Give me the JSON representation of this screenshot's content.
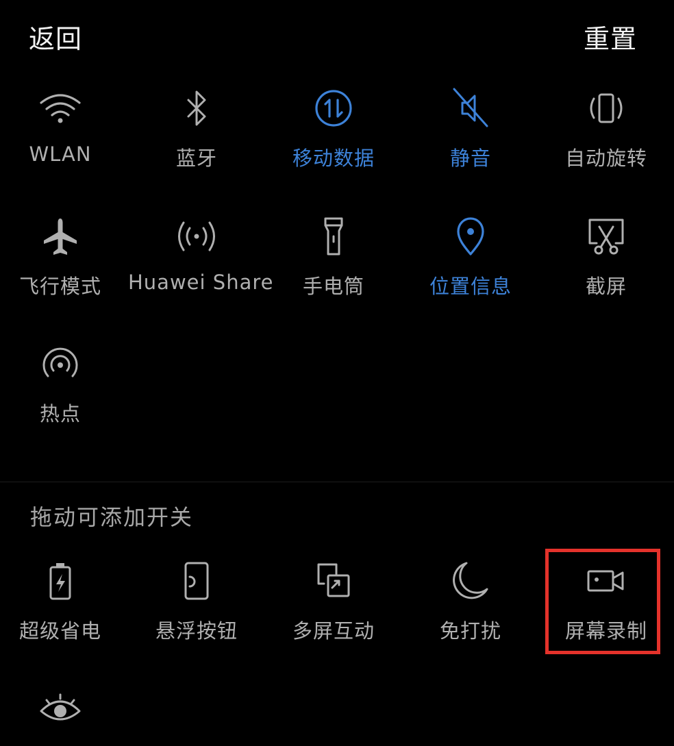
{
  "header": {
    "back_label": "返回",
    "reset_label": "重置"
  },
  "active_tiles": {
    "row1": [
      {
        "id": "wlan",
        "label": "WLAN",
        "icon": "wifi-icon",
        "on": false
      },
      {
        "id": "bluetooth",
        "label": "蓝牙",
        "icon": "bluetooth-icon",
        "on": false
      },
      {
        "id": "mobile-data",
        "label": "移动数据",
        "icon": "mobile-data-icon",
        "on": true
      },
      {
        "id": "mute",
        "label": "静音",
        "icon": "mute-icon",
        "on": true
      },
      {
        "id": "auto-rotate",
        "label": "自动旋转",
        "icon": "rotate-icon",
        "on": false
      }
    ],
    "row2": [
      {
        "id": "airplane",
        "label": "飞行模式",
        "icon": "airplane-icon",
        "on": false
      },
      {
        "id": "huawei-share",
        "label": "Huawei Share",
        "icon": "share-signal-icon",
        "on": false
      },
      {
        "id": "flashlight",
        "label": "手电筒",
        "icon": "flashlight-icon",
        "on": false
      },
      {
        "id": "location",
        "label": "位置信息",
        "icon": "location-pin-icon",
        "on": true
      },
      {
        "id": "screenshot",
        "label": "截屏",
        "icon": "screenshot-icon",
        "on": false
      }
    ],
    "row3": [
      {
        "id": "hotspot",
        "label": "热点",
        "icon": "hotspot-icon",
        "on": false
      }
    ]
  },
  "drag_section": {
    "title": "拖动可添加开关",
    "tiles": [
      {
        "id": "super-power-saving",
        "label": "超级省电",
        "icon": "battery-bolt-icon"
      },
      {
        "id": "floating-button",
        "label": "悬浮按钮",
        "icon": "floating-button-icon"
      },
      {
        "id": "multi-screen",
        "label": "多屏互动",
        "icon": "multi-screen-icon"
      },
      {
        "id": "do-not-disturb",
        "label": "免打扰",
        "icon": "moon-icon"
      },
      {
        "id": "screen-record",
        "label": "屏幕录制",
        "icon": "video-camera-icon",
        "highlighted": true
      }
    ],
    "extra_icon": "eye-icon"
  },
  "colors": {
    "background": "#000000",
    "active_blue": "#3d82d8",
    "inactive_gray": "#b0b0b0",
    "highlight_red": "#e4322b"
  }
}
